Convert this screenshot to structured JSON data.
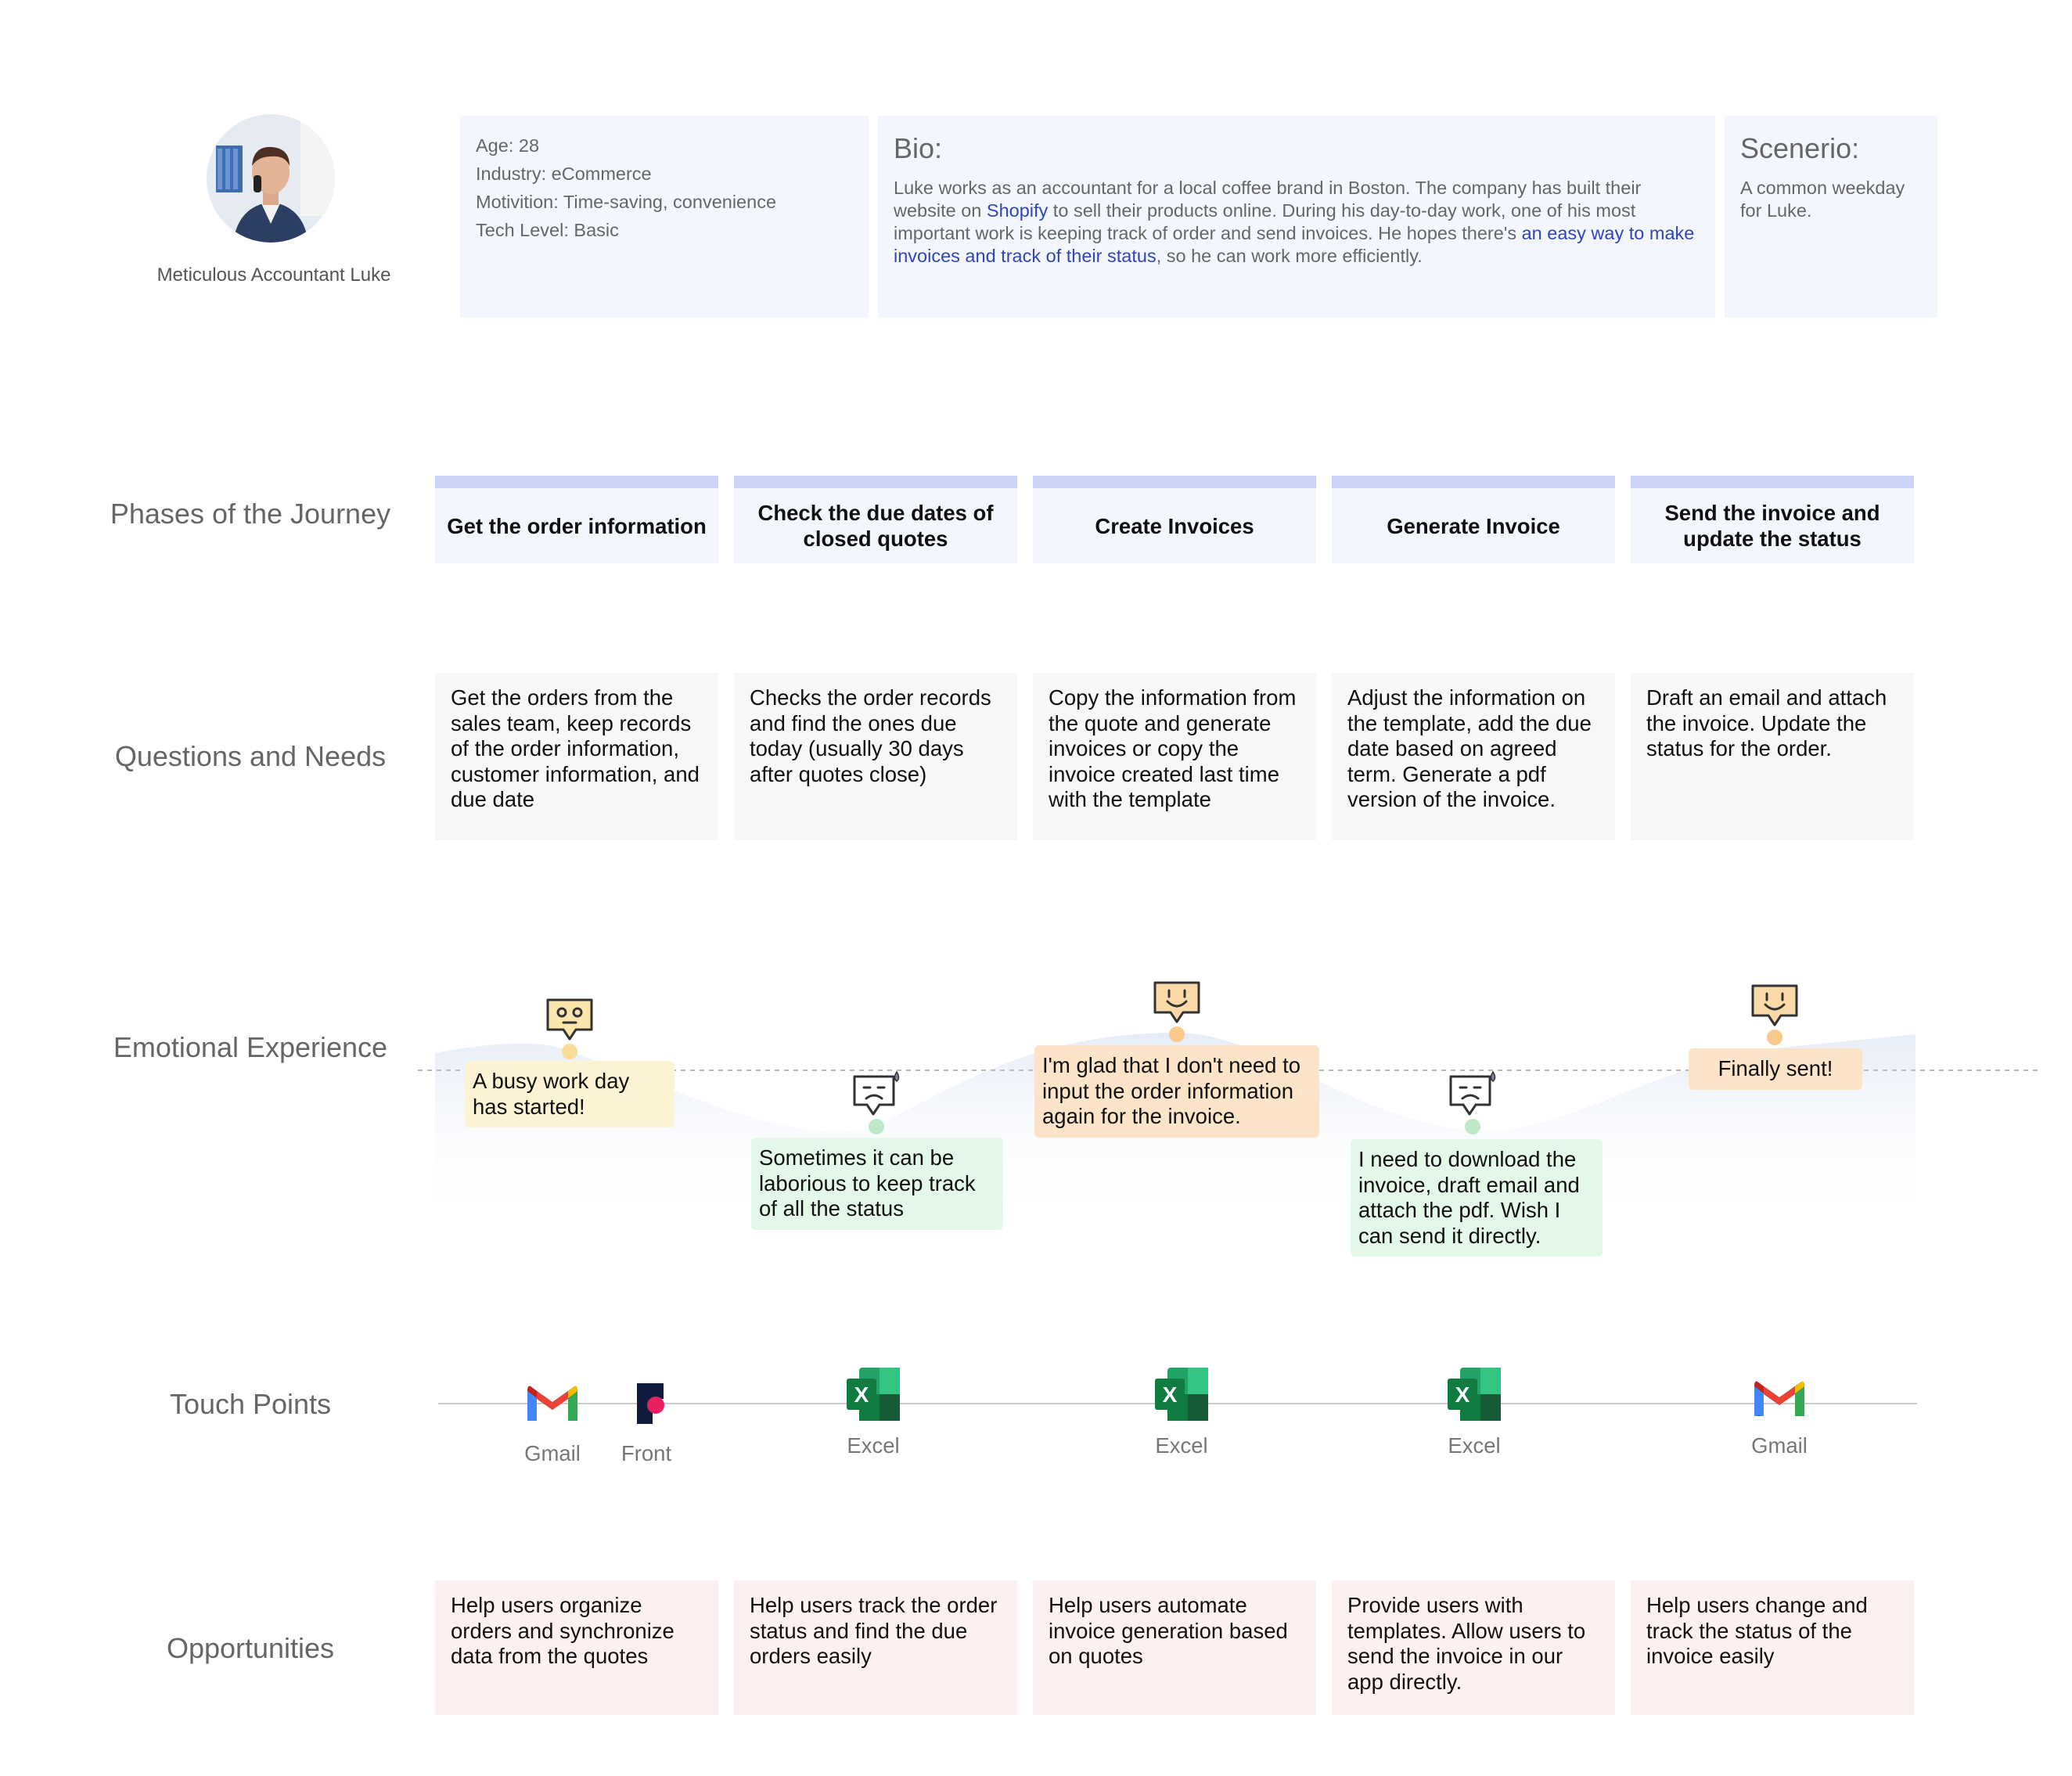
{
  "persona": {
    "name": "Meticulous Accountant Luke",
    "age": "Age: 28",
    "industry": "Industry: eCommerce",
    "motivation": "Motivition: Time-saving, convenience",
    "tech_level": "Tech Level: Basic",
    "bio_title": "Bio:",
    "bio_part1": "Luke works as an accountant for a local coffee brand in Boston. The company has built their website on ",
    "bio_link1": "Shopify",
    "bio_part2": " to sell their products online. During his day-to-day work, one of his most important work is keeping track of order and send invoices. He hopes there's ",
    "bio_link2": "an easy way to make invoices and track of their status",
    "bio_part3": ", so he can work more efficiently.",
    "scenario_title": "Scenerio:",
    "scenario_text": "A common weekday for Luke."
  },
  "rows": {
    "phases": "Phases of the Journey",
    "needs": "Questions and Needs",
    "emotion": "Emotional Experience",
    "touch": "Touch Points",
    "opportunities": "Opportunities"
  },
  "phases": [
    "Get the order information",
    "Check the due dates of closed quotes",
    "Create Invoices",
    "Generate Invoice",
    "Send the invoice and update the status"
  ],
  "needs": [
    "Get the orders from the sales team, keep records of the order information, customer information, and due date",
    "Checks the order records and find the ones due today (usually 30 days after quotes close)",
    "Copy the information from the quote and generate invoices or copy the invoice created last time with the template",
    "Adjust the information on the template, add the due date based on agreed term. Generate a pdf version of the invoice.",
    "Draft an email and attach the invoice. Update the status for the order."
  ],
  "emotions": [
    {
      "text": "A busy work day has started!",
      "mood": "neutral",
      "color": "#fbf3d4"
    },
    {
      "text": "Sometimes it can be laborious to keep track of all the status",
      "mood": "frustrated",
      "color": "#e3f8e6"
    },
    {
      "text": "I'm glad that I don't need to input the order information again for the invoice.",
      "mood": "happy",
      "color": "#fbe4c8"
    },
    {
      "text": "I need to download the invoice, draft email and attach the pdf. Wish I can send it directly.",
      "mood": "frustrated",
      "color": "#e3f8e6"
    },
    {
      "text": "Finally sent!",
      "mood": "happy",
      "color": "#fbe4c8"
    }
  ],
  "touch_points": [
    {
      "label": "Gmail",
      "icon": "gmail-icon"
    },
    {
      "label": "Front",
      "icon": "front-icon"
    },
    {
      "label": "Excel",
      "icon": "excel-icon"
    },
    {
      "label": "Excel",
      "icon": "excel-icon"
    },
    {
      "label": "Excel",
      "icon": "excel-icon"
    },
    {
      "label": "Gmail",
      "icon": "gmail-icon"
    }
  ],
  "opportunities": [
    "Help users organize orders and synchronize data from the quotes",
    "Help users track the order status and find the due orders easily",
    "Help users automate invoice generation based on quotes",
    "Provide users with templates. Allow users to send the invoice in our app directly.",
    "Help users change and track the status of the invoice easily"
  ],
  "colors": {
    "phase_accent": "#cbd3f8",
    "card_bg": "#f3f6fd",
    "needs_bg": "#f7f7f7",
    "opportunity_bg": "#fdf0f0",
    "link": "#2f46b4"
  }
}
